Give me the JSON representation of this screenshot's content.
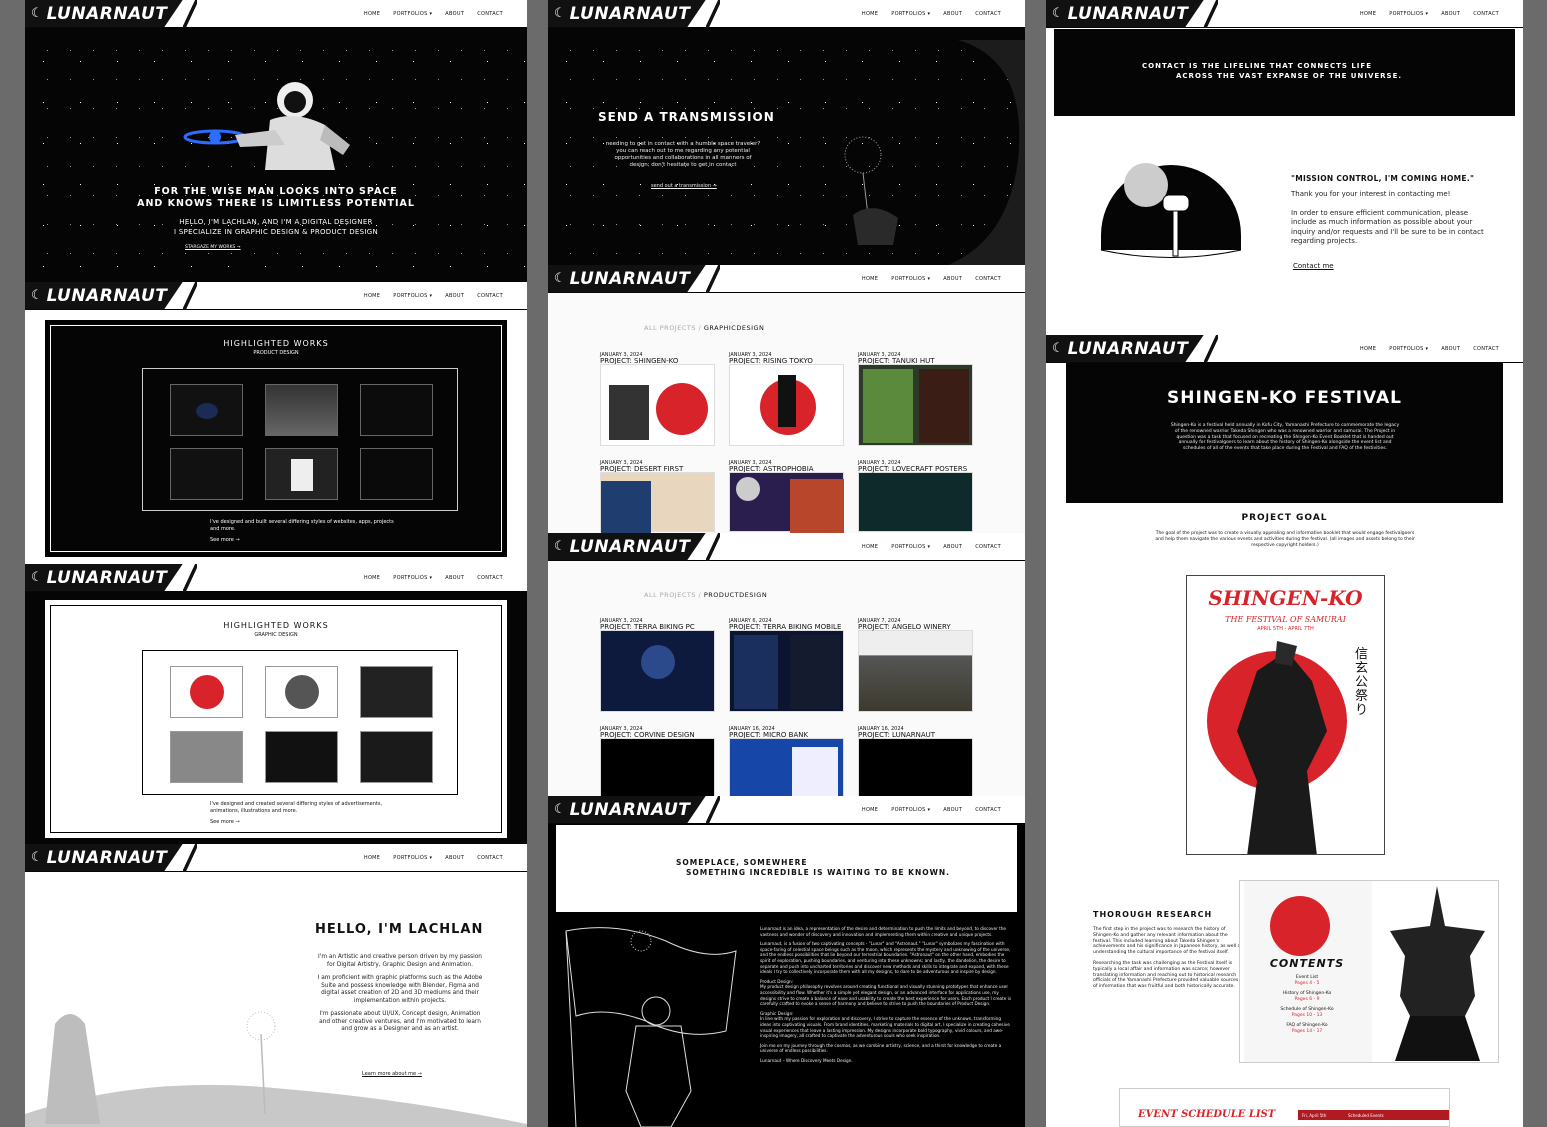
{
  "brand": {
    "logo_text": "LUNARNAUT"
  },
  "nav": {
    "home": "HOME",
    "portfolios": "PORTFOLIOS ▾",
    "about": "ABOUT",
    "contact": "CONTACT"
  },
  "hero": {
    "tagline_1": "FOR THE WISE MAN LOOKS INTO SPACE",
    "tagline_2": "AND KNOWS THERE IS LIMITLESS POTENTIAL",
    "intro_1": "HELLO, I'M LACHLAN, AND I'M A DIGITAL DESIGNER",
    "intro_2": "I SPECIALIZE IN GRAPHIC DESIGN & PRODUCT DESIGN",
    "cta": "STARGAZE MY WORKS →"
  },
  "highlight_product": {
    "title": "HIGHLIGHTED WORKS",
    "subtitle": "PRODUCT DESIGN",
    "desc": "I've designed and built several differing styles of websites, apps, projects and more.",
    "link": "See more →"
  },
  "highlight_graphic": {
    "title": "HIGHLIGHTED WORKS",
    "subtitle": "GRAPHIC DESIGN",
    "desc": "I've designed and created several differing styles of advertisements, animations, illustrations and more.",
    "link": "See more →"
  },
  "about": {
    "title": "HELLO, I'M LACHLAN",
    "p1": "I'm an Artistic and creative person driven by my passion for Digital Artistry, Graphic Design and Animation.",
    "p2": "I am proficient with graphic platforms such as the Adobe Suite and possess knowledge with Blender, Figma and digital asset creation of 2D and 3D mediums and their implementation within projects.",
    "p3": "I'm passionate about UI/UX, Concept design, Animation and other creative ventures, and I'm motivated to learn and grow as a Designer and as an artist.",
    "link": "Learn more about me →"
  },
  "transmission": {
    "title": "SEND A TRANSMISSION",
    "body": "needing to get in contact with a humble space traveler? you can reach out to me regarding any potential opportunities and collaborations in all manners of design; don't hesitate to get in contact",
    "link": "send out a transmission →"
  },
  "graphic_list": {
    "breadcrumb_all": "ALL PROJECTS",
    "breadcrumb_sep": "/",
    "breadcrumb_current": "GRAPHICDESIGN",
    "projects": [
      {
        "date": "JANUARY 3, 2024",
        "name": "PROJECT: SHINGEN-KO"
      },
      {
        "date": "JANUARY 3, 2024",
        "name": "PROJECT: RISING TOKYO"
      },
      {
        "date": "JANUARY 3, 2024",
        "name": "PROJECT: TANUKI HUT"
      },
      {
        "date": "JANUARY 3, 2024",
        "name": "PROJECT: DESERT FIRST"
      },
      {
        "date": "JANUARY 3, 2024",
        "name": "PROJECT: ASTROPHOBIA"
      },
      {
        "date": "JANUARY 3, 2024",
        "name": "PROJECT: LOVECRAFT POSTERS"
      }
    ]
  },
  "product_list": {
    "breadcrumb_all": "ALL PROJECTS",
    "breadcrumb_sep": "/",
    "breadcrumb_current": "PRODUCTDESIGN",
    "projects": [
      {
        "date": "JANUARY 3, 2024",
        "name": "PROJECT: TERRA BIKING PC"
      },
      {
        "date": "JANUARY 6, 2024",
        "name": "PROJECT: TERRA BIKING MOBILE"
      },
      {
        "date": "JANUARY 7, 2024",
        "name": "PROJECT: ANGELO WINERY"
      },
      {
        "date": "JANUARY 3, 2024",
        "name": "PROJECT: CORVINE DESIGN"
      },
      {
        "date": "JANUARY 16, 2024",
        "name": "PROJECT: MICRO BANK"
      },
      {
        "date": "JANUARY 16, 2024",
        "name": "PROJECT: LUNARNAUT"
      }
    ]
  },
  "about_brand": {
    "banner_1": "SOMEPLACE, SOMEWHERE",
    "banner_2": "SOMETHING INCREDIBLE IS WAITING TO BE KNOWN.",
    "p1": "Lunarnaut is an idea, a representation of the desire and determination to push the limits and beyond, to discover the vastness and wonder of discovery and innovation and implementing them within creative and unique projects.",
    "p2": "Lunarnaut, is a fusion of two captivating concepts - \"Lunar\" and \"Astronaut.\" \"Lunar\" symbolizes my fascination with space-faring of celestial space beings such as the moon, which represents the mystery and unknowing of the universe, and the endless possibilities that lie beyond our terrestrial boundaries. \"Astronaut\" on the other hand, embodies the spirit of exploration, pushing boundaries, and venturing into these unknowns; and lastly, the dandelion, the desire to separate and push into uncharted territories and discover new methods and skills to integrate and expand, with these ideals I try to collectively incorporate them with all my designs, to dare to be adventurous and inspire by design.",
    "h_product": "Product Design:",
    "p_product": "My product design philosophy revolves around creating functional and visually stunning prototypes that enhance user accessibility and flow. Whether it's a simple yet elegant design, or an advanced interface for applications use, my designs strive to create a balance of ease and usability to create the best experience for users. Each product I create is carefully crafted to evoke a sense of harmony and believe to strive to push the boundaries of Product Design.",
    "h_graphic": "Graphic Design:",
    "p_graphic": "In line with my passion for exploration and discovery, I strive to capture the essence of the unknown, transforming ideas into captivating visuals. From brand identities, marketing materials to digital art, I specialize in creating cohesive visual experiences that leave a lasting impression. My designs incorporate bold typography, vivid colours, and awe-inspiring imagery, all crafted to captivate the adventurous souls who seek inspiration.",
    "p_join": "Join me on my journey through the cosmos, as we combine artistry, science, and a thirst for knowledge to create a universe of endless possibilities.",
    "p_sign": "Lunarnaut – Where Discovery Meets Design."
  },
  "contact": {
    "banner_1": "CONTACT IS THE LIFELINE THAT CONNECTS LIFE",
    "banner_2": "ACROSS THE VAST EXPANSE OF THE UNIVERSE.",
    "heading": "\"MISSION CONTROL, I'M COMING HOME.\"",
    "p1": "Thank you for your interest in contacting me!",
    "p2": "In order to ensure efficient communication, please include as much information as possible about your inquiry and/or requests and I'll be sure to be in contact regarding projects.",
    "link": "Contact me"
  },
  "shingen": {
    "title": "SHINGEN-KO FESTIVAL",
    "intro": "Shingen-Ko is a festival held annually in Kofu City, Yamanashi Prefecture to commemorate the legacy of the renowned warrior Takeda Shingen who was a renowned warrior and samurai. The Project in question was a task that focused on recreating the Shingen-Ko Event Booklet that is handed out annually for festivalgoers to learn about the history of Shingen-Ko alongside the event list and schedules of all of the events that take place during the Festival and FAQ of the festivities.",
    "goal_title": "PROJECT GOAL",
    "goal": "The goal of the project was to create a visually appealing and informative booklet that would engage festivalgoers and help them navigate the various events and activities during the festival. (all images and assets belong to their respective copyright holders.)",
    "poster_title": "SHINGEN-KO",
    "poster_sub": "THE FESTIVAL OF SAMURAI",
    "poster_date": "APRIL 5TH - APRIL 7TH",
    "poster_kanji": "信玄公祭り",
    "research_title": "THOROUGH RESEARCH",
    "research_p1": "The first step in the project was to research the history of Shingen-Ko and gather any relevant information about the festival. This included learning about Takeda Shingen's achievements and his significance in Japanese history, as well as understanding the cultural importance of the festival itself.",
    "research_p2": "Researching the task was challenging as the Festival itself is typically a local affair and information was scarce; however translating information and reaching out to historical research officials of the Yamanashi Prefecture provided valuable sources of information that was fruitful and both historically accurate.",
    "contents_title": "CONTENTS",
    "contents": [
      {
        "name": "Event List",
        "pages": "Pages 4 - 5"
      },
      {
        "name": "History of Shingen-Ko",
        "pages": "Pages 6 - 9"
      },
      {
        "name": "Schedule of Shingen-Ko",
        "pages": "Pages 10 - 13"
      },
      {
        "name": "FAQ of Shingen-Ko",
        "pages": "Pages 14 - 17"
      }
    ],
    "schedule_title": "EVENT SCHEDULE LIST",
    "schedule_day": "Fri, April 5th",
    "schedule_col": "Scheduled Events"
  },
  "colors": {
    "accent_red": "#d8232a",
    "black": "#070707",
    "white": "#ffffff",
    "blue_glow": "#2c6cff"
  }
}
